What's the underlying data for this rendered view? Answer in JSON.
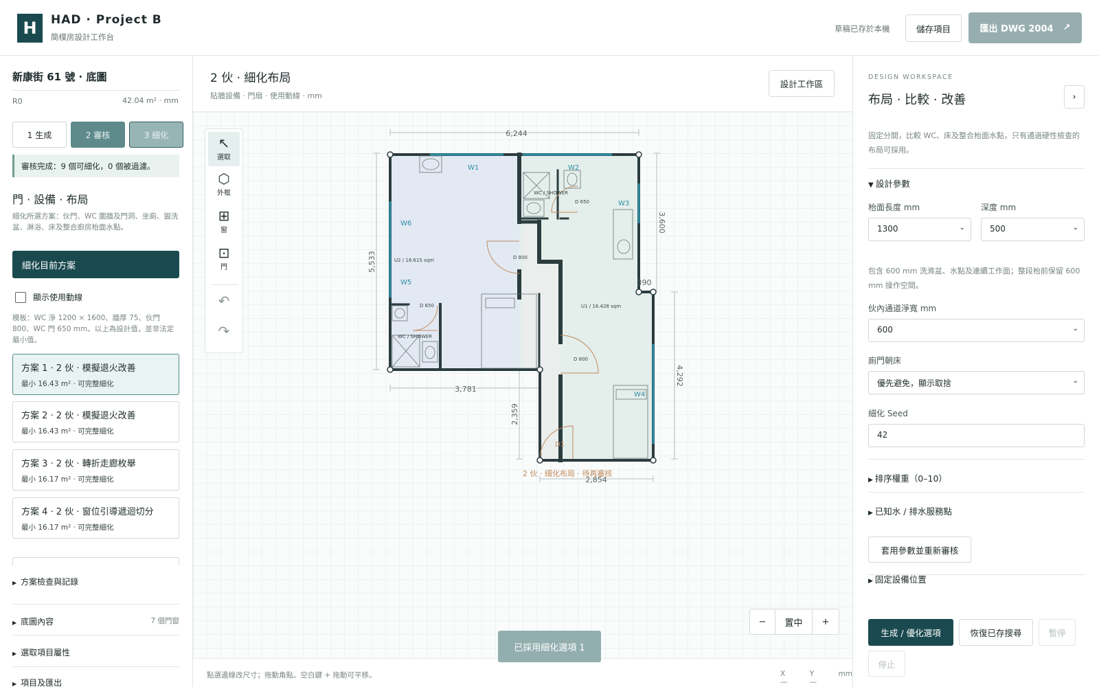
{
  "header": {
    "logo_letter": "H",
    "title": "HAD · Project B",
    "subtitle": "簡樸房設計工作台",
    "save_status": "草稿已存於本機",
    "save_button": "儲存項目",
    "export_button": "匯出 DWG 2004",
    "export_icon": "↗"
  },
  "left": {
    "plan_title": "新康街 61 號 · 底圖",
    "revision": "R0",
    "area": "42.04 m² · mm",
    "steps": [
      "1 生成",
      "2 審核",
      "3 細化"
    ],
    "review_notice": "審核完成：9 個可細化，0 個被過濾。",
    "section_title": "門 · 設備 · 布局",
    "section_desc": "細化所選方案：伙門、WC 圍牆及門洞、坐廁、盥洗盆、淋浴、床及整合廚房枱面水點。",
    "refine_button": "細化目前方案",
    "show_paths_label": "顯示使用動線",
    "template_note": "模板：WC 淨 1200 × 1600、牆厚 75、伙門 800、WC 門 650 mm。以上為設計值，並非法定最小值。",
    "options": [
      {
        "title": "方案 1 · 2 伙 · 模擬退火改善",
        "sub": "最小 16.43 m² · 可完整細化"
      },
      {
        "title": "方案 2 · 2 伙 · 模擬退火改善",
        "sub": "最小 16.43 m² · 可完整細化"
      },
      {
        "title": "方案 3 · 2 伙 · 轉折走廊枚舉",
        "sub": "最小 16.17 m² · 可完整細化"
      },
      {
        "title": "方案 4 · 2 伙 · 窗位引導遞迴切分",
        "sub": "最小 16.17 m² · 可完整細化"
      }
    ],
    "accordions": {
      "review_log": "方案檢查與記錄",
      "base_content": "底圖內容",
      "base_meta": "7 個門窗",
      "properties": "選取項目屬性",
      "project_export": "項目及匯出"
    }
  },
  "center": {
    "title": "2 伙 · 細化布局",
    "subtitle": "貼牆設備 · 門扇 · 使用動線 · mm",
    "workspace_button": "設計工作區",
    "tools": [
      {
        "icon": "↖",
        "label": "選取"
      },
      {
        "icon": "⬡",
        "label": "外框"
      },
      {
        "icon": "⊞",
        "label": "窗"
      },
      {
        "icon": "⊡",
        "label": "門"
      }
    ],
    "undo_icon": "↶",
    "redo_icon": "↷",
    "plan": {
      "dims": [
        "6,244",
        "5,533",
        "3,781",
        "3,600",
        "390",
        "4,292",
        "2,359",
        "2,854"
      ],
      "windows": [
        "W1",
        "W2",
        "W3",
        "W4",
        "W5",
        "W6"
      ],
      "doors": [
        "D 650",
        "D 800",
        "D 800",
        "D 650"
      ],
      "entry": "D1",
      "wc_label": "WC / SHOWER",
      "unit1": "U1 / 16.428 sqm",
      "unit2": "U2 / 18.615 sqm",
      "caption": "2 伙 · 細化布局 · 待再審核"
    },
    "zoom_out": "−",
    "zoom_center": "置中",
    "zoom_in": "+",
    "toast": "已採用細化選項 1",
    "status_hint": "點選邊線改尺寸；拖動角點。空白鍵 + 拖動可平移。",
    "coord_x": "X —",
    "coord_y": "Y —",
    "coord_unit": "mm"
  },
  "right": {
    "kicker": "DESIGN WORKSPACE",
    "title": "布局 · 比較 · 改善",
    "toggle": "›",
    "desc": "固定分間，比較 WC、床及整合枱面水點，只有通過硬性檢查的布局可採用。",
    "params_title": "設計參數",
    "counter_len_label": "枱面長度 mm",
    "counter_len_value": "1300",
    "depth_label": "深度 mm",
    "depth_value": "500",
    "counter_note": "包含 600 mm 洗滌盆、水點及連續工作面；整段枱前保留 600 mm 操作空間。",
    "corridor_label": "伙內通道淨寬 mm",
    "corridor_value": "600",
    "toilet_door_label": "廁門朝床",
    "toilet_door_value": "優先避免，顯示取捨",
    "seed_label": "細化 Seed",
    "seed_value": "42",
    "sort_weights": "排序權重（0–10）",
    "known_points": "已知水 / 排水服務點",
    "apply_button": "套用參數並重新審核",
    "fixed_equipment": "固定設備位置",
    "generate_button": "生成 / 優化選項",
    "restore_button": "恢復已存搜尋",
    "pause_button": "暫停",
    "stop_button": "停止"
  },
  "colors": {
    "brand": "#1a4a4f",
    "wall": "#2b3c3e",
    "window": "#2f8fa6",
    "door_arc": "#c08a5c",
    "unit1_fill": "#e4eeeb",
    "unit2_fill": "#e3e9f3"
  }
}
